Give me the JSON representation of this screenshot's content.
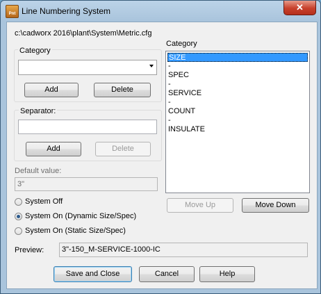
{
  "window": {
    "title": "Line Numbering System",
    "app_icon_text": "Pnt",
    "close_glyph": "✕"
  },
  "config_path": "c:\\cadworx 2016\\plant\\System\\Metric.cfg",
  "category_group": {
    "label": "Category",
    "selected_value": "",
    "add_label": "Add",
    "delete_label": "Delete"
  },
  "separator_group": {
    "label": "Separator:",
    "value": "",
    "add_label": "Add",
    "delete_label": "Delete"
  },
  "default_value": {
    "label": "Default value:",
    "value": "3\""
  },
  "radios": [
    {
      "label": "System Off",
      "checked": false
    },
    {
      "label": "System On (Dynamic Size/Spec)",
      "checked": true
    },
    {
      "label": "System On (Static Size/Spec)",
      "checked": false
    }
  ],
  "category_list": {
    "label": "Category",
    "items": [
      "SIZE",
      "-",
      "SPEC",
      "-",
      "SERVICE",
      "-",
      "COUNT",
      "-",
      "INSULATE"
    ],
    "selected_index": 0
  },
  "move_up_label": "Move Up",
  "move_down_label": "Move Down",
  "preview": {
    "label": "Preview:",
    "value": "3\"-150_M-SERVICE-1000-IC"
  },
  "footer": {
    "save_label": "Save and Close",
    "cancel_label": "Cancel",
    "help_label": "Help"
  }
}
